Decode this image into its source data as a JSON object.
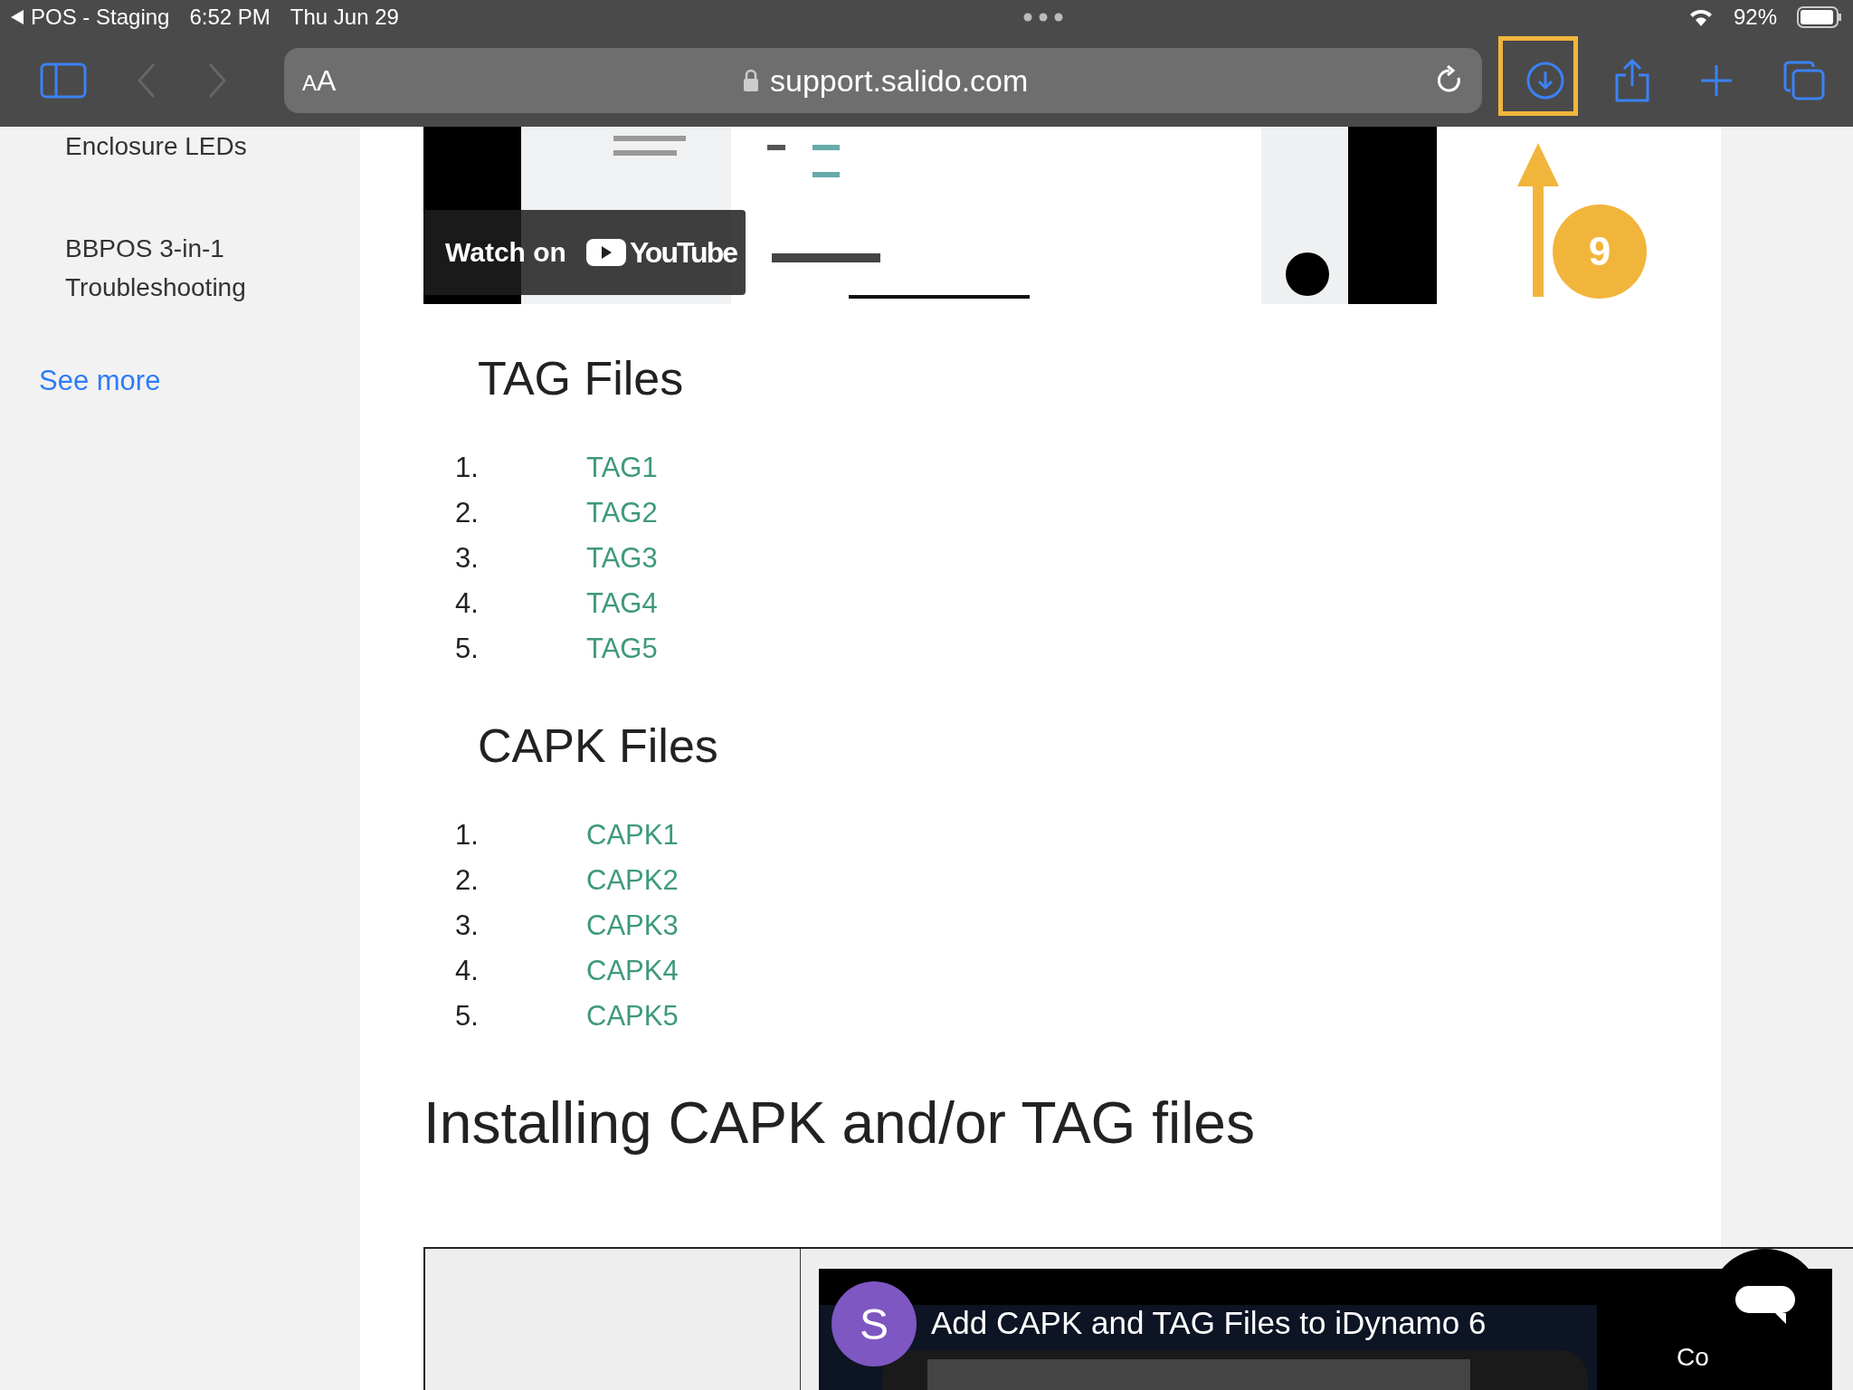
{
  "status_bar": {
    "back_label": "POS - Staging",
    "time": "6:52 PM",
    "date": "Thu Jun 29",
    "battery": "92%"
  },
  "toolbar": {
    "text_size": "AA",
    "url": "support.salido.com"
  },
  "sidebar": {
    "items": [
      "Enclosure LEDs",
      "BBPOS 3-in-1 Troubleshooting"
    ],
    "see_more": "See more"
  },
  "top_video": {
    "watch_on": "Watch on",
    "brand": "YouTube"
  },
  "sections": [
    {
      "heading": "TAG Files",
      "items": [
        {
          "number": "1.",
          "link": "TAG1"
        },
        {
          "number": "2.",
          "link": "TAG2"
        },
        {
          "number": "3.",
          "link": "TAG3"
        },
        {
          "number": "4.",
          "link": "TAG4"
        },
        {
          "number": "5.",
          "link": "TAG5"
        }
      ]
    },
    {
      "heading": "CAPK Files",
      "items": [
        {
          "number": "1.",
          "link": "CAPK1"
        },
        {
          "number": "2.",
          "link": "CAPK2"
        },
        {
          "number": "3.",
          "link": "CAPK3"
        },
        {
          "number": "4.",
          "link": "CAPK4"
        },
        {
          "number": "5.",
          "link": "CAPK5"
        }
      ]
    }
  ],
  "main_heading": "Installing CAPK and/or TAG files",
  "embed_video": {
    "avatar": "S",
    "title": "Add CAPK and TAG Files to iDynamo 6",
    "side_text": "Co"
  },
  "annotation": {
    "step": "9"
  }
}
